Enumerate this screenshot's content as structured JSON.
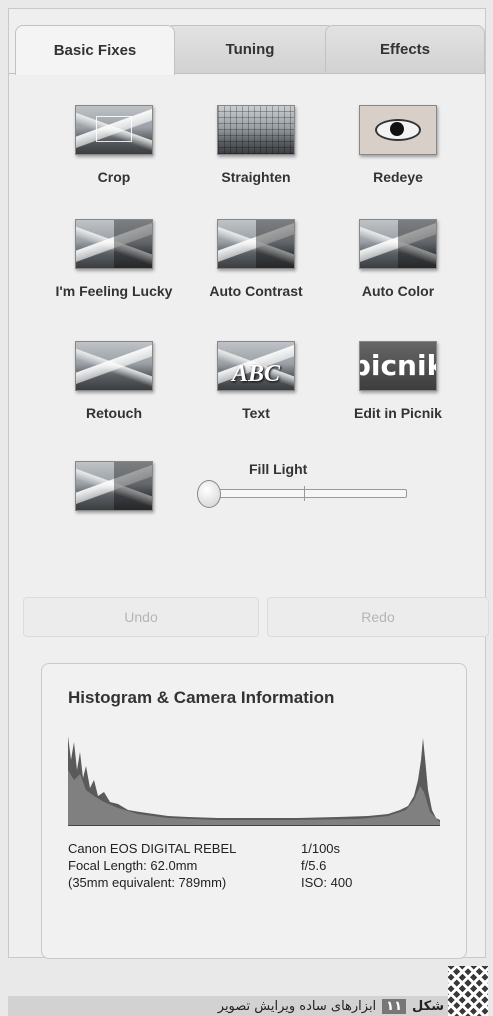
{
  "tabs": [
    {
      "label": "Basic Fixes",
      "active": true
    },
    {
      "label": "Tuning",
      "active": false
    },
    {
      "label": "Effects",
      "active": false
    }
  ],
  "tools": {
    "crop": "Crop",
    "straighten": "Straighten",
    "redeye": "Redeye",
    "lucky": "I'm Feeling Lucky",
    "auto_contrast": "Auto Contrast",
    "auto_color": "Auto Color",
    "retouch": "Retouch",
    "text": "Text",
    "edit_picnik": "Edit in Picnik",
    "text_thumb": "ABC",
    "picnik_logo": "picnik"
  },
  "fill_light": {
    "label": "Fill Light",
    "value": 0
  },
  "actions": {
    "undo": "Undo",
    "redo": "Redo"
  },
  "histogram": {
    "title": "Histogram & Camera Information",
    "camera_model": "Canon EOS DIGITAL REBEL",
    "focal_length": "Focal Length: 62.0mm",
    "equivalent": "(35mm equivalent: 789mm)",
    "shutter": "1/100s",
    "aperture": "f/5.6",
    "iso": "ISO: 400"
  },
  "caption": {
    "label": "شکل",
    "number": "۱۱",
    "text": "ابزارهای ساده ویرایش تصویر"
  },
  "colors": {
    "panel_bg": "#efefef",
    "tab_active": "#f4f4f4",
    "tab_inactive": "#d8d8d8",
    "histogram_fill": "#555555"
  }
}
